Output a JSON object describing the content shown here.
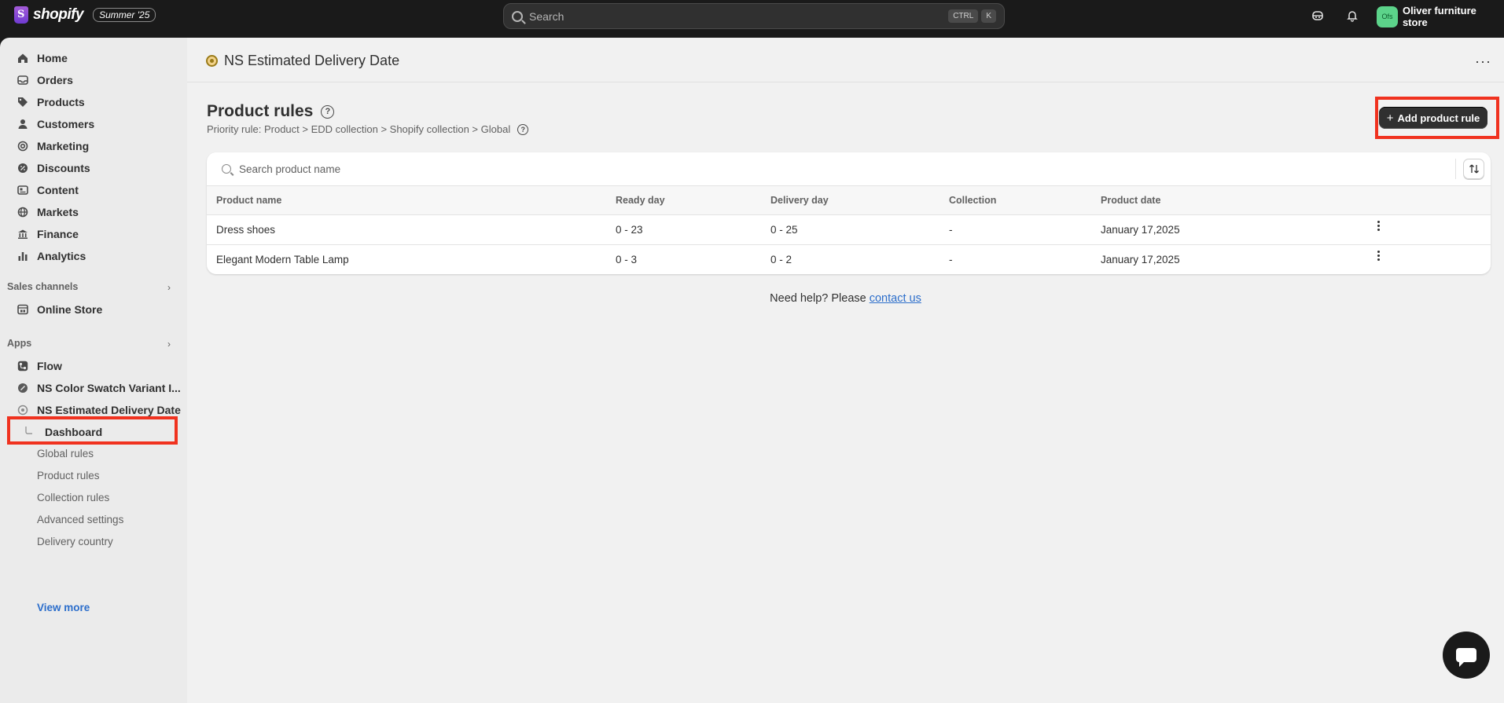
{
  "topbar": {
    "brand": "shopify",
    "edition": "Summer '25",
    "search_placeholder": "Search",
    "kbd_ctrl": "CTRL",
    "kbd_k": "K",
    "store_initials": "Ofs",
    "store_name": "Oliver furniture store"
  },
  "sidebar": {
    "items": [
      {
        "label": "Home",
        "icon": "home-icon"
      },
      {
        "label": "Orders",
        "icon": "inbox-icon"
      },
      {
        "label": "Products",
        "icon": "tag-icon"
      },
      {
        "label": "Customers",
        "icon": "person-icon"
      },
      {
        "label": "Marketing",
        "icon": "target-icon"
      },
      {
        "label": "Discounts",
        "icon": "discount-icon"
      },
      {
        "label": "Content",
        "icon": "content-icon"
      },
      {
        "label": "Markets",
        "icon": "globe-icon"
      },
      {
        "label": "Finance",
        "icon": "bank-icon"
      },
      {
        "label": "Analytics",
        "icon": "bar-chart-icon"
      }
    ],
    "sales_channels_label": "Sales channels",
    "online_store_label": "Online Store",
    "apps_label": "Apps",
    "apps": [
      {
        "label": "Flow"
      },
      {
        "label": "NS Color Swatch Variant I..."
      },
      {
        "label": "NS Estimated Delivery Date"
      }
    ],
    "subitems": [
      {
        "label": "Dashboard"
      },
      {
        "label": "Global rules"
      },
      {
        "label": "Product rules"
      },
      {
        "label": "Collection rules"
      },
      {
        "label": "Advanced settings"
      },
      {
        "label": "Delivery country"
      }
    ],
    "view_more": "View more"
  },
  "main": {
    "app_title": "NS Estimated Delivery Date",
    "heading": "Product rules",
    "priority_rule": "Priority rule: Product > EDD collection > Shopify collection > Global",
    "add_button": "Add product rule",
    "search_placeholder": "Search product name",
    "columns": [
      "Product name",
      "Ready day",
      "Delivery day",
      "Collection",
      "Product date"
    ],
    "rows": [
      {
        "name": "Dress shoes",
        "ready": "0 - 23",
        "delivery": "0 - 25",
        "collection": "-",
        "date": "January 17,2025"
      },
      {
        "name": "Elegant Modern Table Lamp",
        "ready": "0 - 3",
        "delivery": "0 - 2",
        "collection": "-",
        "date": "January 17,2025"
      }
    ],
    "help_text": "Need help? Please",
    "help_link": "contact us"
  },
  "colors": {
    "highlight": "#f0321f",
    "link": "#2c6ecb",
    "topbar": "#1a1a1a",
    "store_avatar": "#5cd38a"
  }
}
